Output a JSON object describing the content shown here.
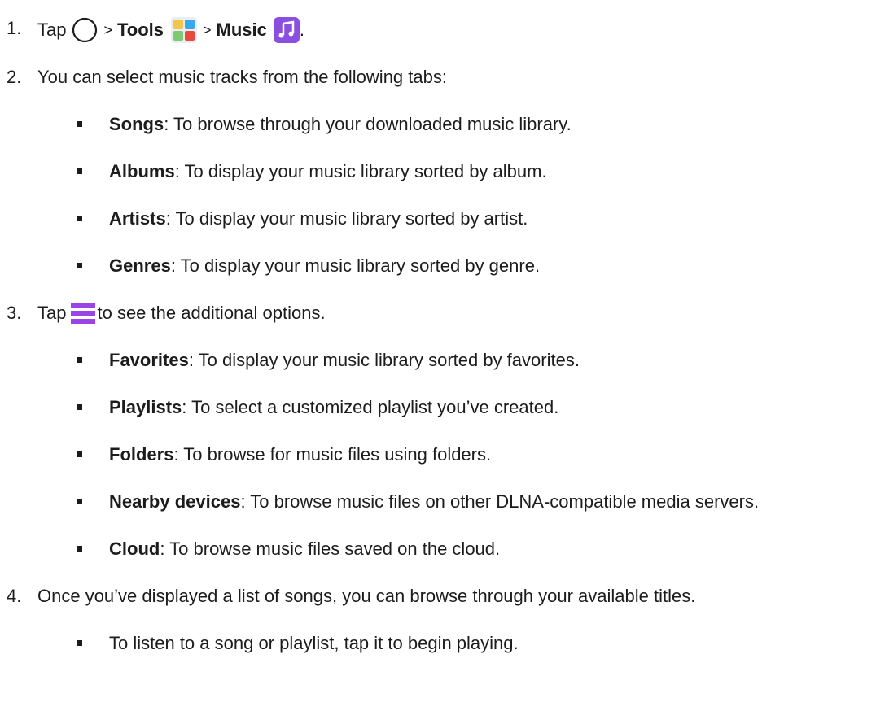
{
  "steps": [
    {
      "num": "1.",
      "tap": "Tap",
      "sep1": ">",
      "tools": "Tools",
      "sep2": ">",
      "music": "Music",
      "end": "."
    },
    {
      "num": "2.",
      "text": "You can select music tracks from the following tabs:",
      "items": [
        {
          "term": "Songs",
          "desc": ": To browse through your downloaded music library."
        },
        {
          "term": "Albums",
          "desc": ": To display your music library sorted by album."
        },
        {
          "term": "Artists",
          "desc": ": To display your music library sorted by artist."
        },
        {
          "term": "Genres",
          "desc": ": To display your music library sorted by genre."
        }
      ]
    },
    {
      "num": "3.",
      "tap": "Tap",
      "text_after": "to see the additional options.",
      "items": [
        {
          "term": "Favorites",
          "desc": ": To display your music library sorted by favorites."
        },
        {
          "term": "Playlists",
          "desc": ": To select a customized playlist you’ve created."
        },
        {
          "term": "Folders",
          "desc": ": To browse for music files using folders."
        },
        {
          "term": "Nearby devices",
          "desc": ": To browse music files on other DLNA-compatible media servers."
        },
        {
          "term": "Cloud",
          "desc": ": To browse music files saved on the cloud."
        }
      ]
    },
    {
      "num": "4.",
      "text": "Once you’ve displayed a list of songs, you can browse through your available titles.",
      "items": [
        {
          "desc": "To listen to a song or playlist, tap it to begin playing."
        }
      ]
    }
  ],
  "icons": {
    "home": "home-circle-icon",
    "tools": "tools-folder-icon",
    "music": "music-app-icon",
    "menu": "menu-icon"
  },
  "colors": {
    "music_icon": "#8a4fe0",
    "menu_icon": "#9a44e6"
  }
}
